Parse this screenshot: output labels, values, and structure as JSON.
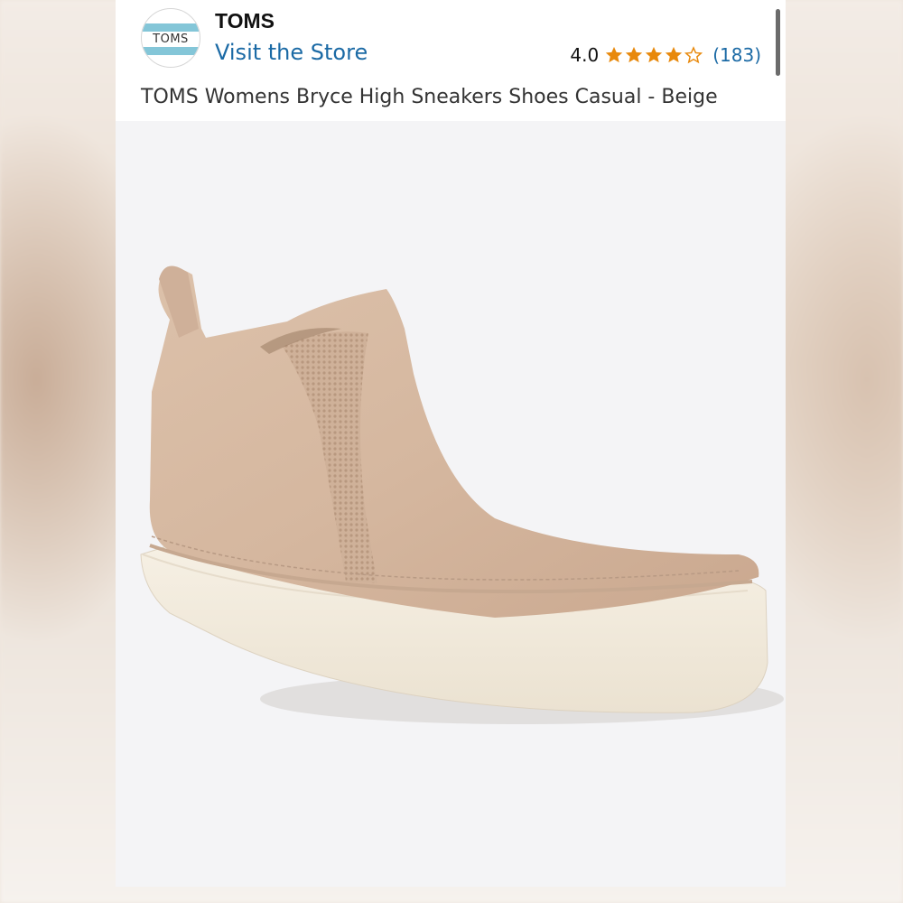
{
  "header": {
    "brand_name": "TOMS",
    "logo_text": "TOMS",
    "visit_store_label": "Visit the Store",
    "rating_value": "4.0",
    "rating_stars": 4,
    "rating_max": 5,
    "rating_count": "(183)",
    "product_title": "TOMS Womens Bryce High Sneakers Shoes Casual - Beige"
  },
  "colors": {
    "link": "#1b6aa5",
    "star": "#e8890c",
    "logo_band": "#84c6d8"
  },
  "product_image": {
    "icon": "beige-suede-high-top-sneaker"
  }
}
